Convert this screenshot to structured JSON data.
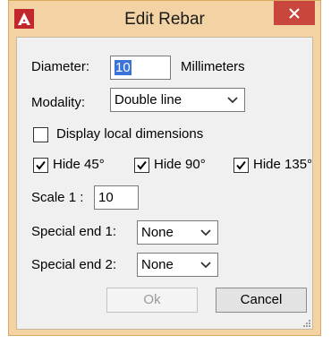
{
  "window": {
    "title": "Edit Rebar",
    "colors": {
      "frame": "#f3d3a4",
      "close": "#c9463d",
      "icon": "#c4262e",
      "selection": "#3a74d9"
    }
  },
  "form": {
    "diameter": {
      "label": "Diameter:",
      "value": "10",
      "unit": "Millimeters"
    },
    "modality": {
      "label": "Modality:",
      "value": "Double line"
    },
    "display_local_dimensions": {
      "label": "Display local dimensions",
      "checked": false
    },
    "hide_45": {
      "label": "Hide 45°",
      "checked": true
    },
    "hide_90": {
      "label": "Hide 90°",
      "checked": true
    },
    "hide_135": {
      "label": "Hide 135°",
      "checked": true
    },
    "scale": {
      "label": "Scale 1 :",
      "value": "10"
    },
    "special_end_1": {
      "label": "Special end 1:",
      "value": "None"
    },
    "special_end_2": {
      "label": "Special end 2:",
      "value": "None"
    }
  },
  "buttons": {
    "ok": "Ok",
    "cancel": "Cancel"
  },
  "icons": {
    "app": "autocad-logo-icon",
    "close": "close-icon",
    "chevron": "chevron-down-icon",
    "check": "checkmark-icon",
    "grip": "resize-grip-icon"
  }
}
